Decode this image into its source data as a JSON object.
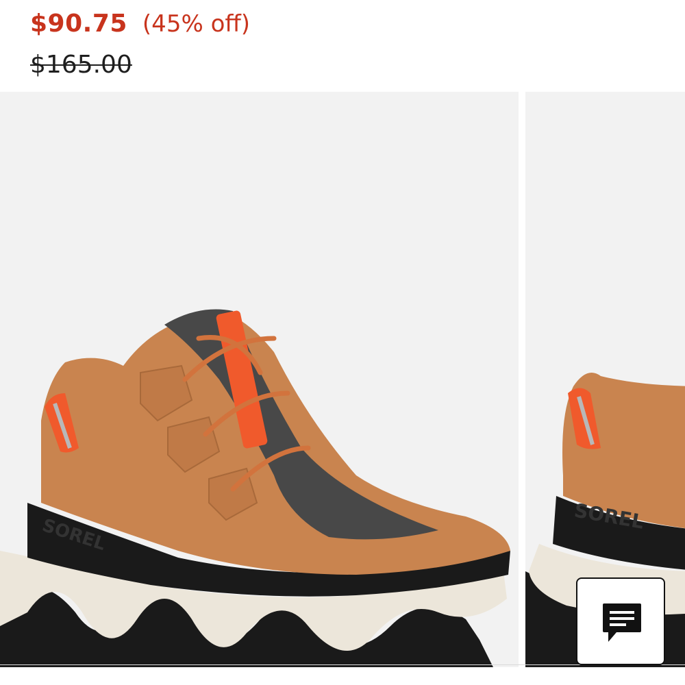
{
  "product": {
    "sale_price": "$90.75",
    "discount": "(45% off)",
    "original_price": "$165.00"
  },
  "gallery": {
    "images": [
      {
        "subject": "Sorel hiking sneaker boot, camel suede with charcoal felt, orange laces, black and cream sole",
        "logo_text": "SOREL"
      },
      {
        "subject": "Sorel hiking sneaker boot, side view",
        "logo_text": "SOREL"
      }
    ]
  },
  "chat": {
    "icon": "chat-bubble-icon"
  },
  "colors": {
    "price_accent": "#c8341d",
    "suede": "#c9844f",
    "felt": "#484848",
    "lace_accent": "#f05a2c",
    "sole_cream": "#ece6da",
    "sole_black": "#1a1a1a"
  }
}
